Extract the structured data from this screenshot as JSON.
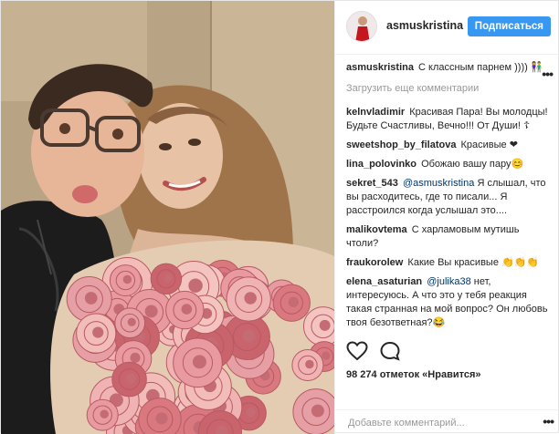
{
  "post": {
    "username": "asmuskristina",
    "follow_label": "Подписаться",
    "caption_user": "asmuskristina",
    "caption_text": "С классным парнем )))) 👫",
    "load_more": "Загрузить еще комментарии",
    "more_icon": "ellipsis-icon",
    "likes": "98 274 отметок «Нравится»",
    "comment_placeholder": "Добавьте комментарий..."
  },
  "comments": [
    {
      "user": "kelnvladimir",
      "text": "Красивая Пара! Вы молодцы! Будьте Счастливы, Вечно!!! От Души! ☦"
    },
    {
      "user": "sweetshop_by_filatova",
      "text": "Красивые ❤"
    },
    {
      "user": "lina_polovinko",
      "text": "Обожаю вашу пару😊"
    },
    {
      "user": "sekret_543",
      "mention": "@asmuskristina",
      "text": "Я слышал, что вы расходитесь, где то писали... Я расстроился когда услышал это...."
    },
    {
      "user": "malikovtema",
      "text": "С харламовым мутишь чтоли?"
    },
    {
      "user": "fraukorolew",
      "text": "Какие Вы красивые 👏👏👏"
    },
    {
      "user": "elena_asaturian",
      "mention": "@julika38",
      "text": "нет, интересуюсь. А что это у тебя реакция такая странная на мой вопрос? Он любовь твоя безответная?😂"
    }
  ],
  "colors": {
    "accent": "#3897f0",
    "text": "#262626",
    "muted": "#999999",
    "mention": "#003569"
  }
}
